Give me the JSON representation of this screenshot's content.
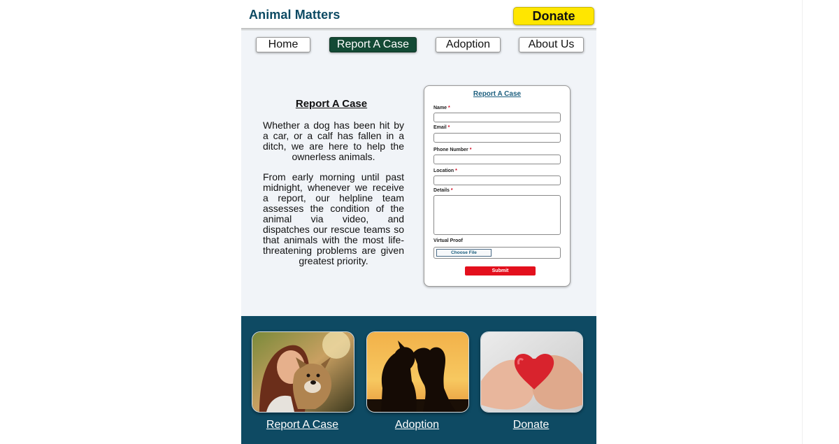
{
  "header": {
    "brand": "Animal Matters",
    "donate_label": "Donate"
  },
  "nav": {
    "items": [
      {
        "label": "Home"
      },
      {
        "label": "Report A Case"
      },
      {
        "label": "Adoption"
      },
      {
        "label": "About Us"
      }
    ],
    "active": "Report A Case"
  },
  "intro": {
    "title": "Report A Case",
    "paragraph1": "Whether a dog has been hit by a car, or a calf has fallen in a ditch, we are here to help the ownerless animals.",
    "paragraph2": "From early morning until past midnight, whenever we receive a report, our helpline team assesses the condition of the animal via video, and dispatches our rescue teams so that animals with the most life-threatening problems are given greatest priority."
  },
  "form": {
    "title": "Report A Case",
    "fields": {
      "name": "Name",
      "email": "Email",
      "phone": "Phone Number",
      "location": "Location",
      "details": "Details",
      "proof": "Virtual Proof"
    },
    "required_mark": "*",
    "choose_file_label": "Choose File",
    "submit_label": "Submit"
  },
  "footer": {
    "cards": [
      {
        "label": "Report A Case",
        "image": "woman-with-dog-photo"
      },
      {
        "label": "Adoption",
        "image": "silhouette-girl-dog-sunset-photo"
      },
      {
        "label": "Donate",
        "image": "hands-holding-heart-photo"
      }
    ]
  },
  "colors": {
    "brand_text": "#0d4a63",
    "donate_yellow": "#ffe600",
    "nav_active": "#134a35",
    "footer_bg": "#0e4a63",
    "submit_red": "#e3101d",
    "page_bg": "#f1f4f8"
  }
}
